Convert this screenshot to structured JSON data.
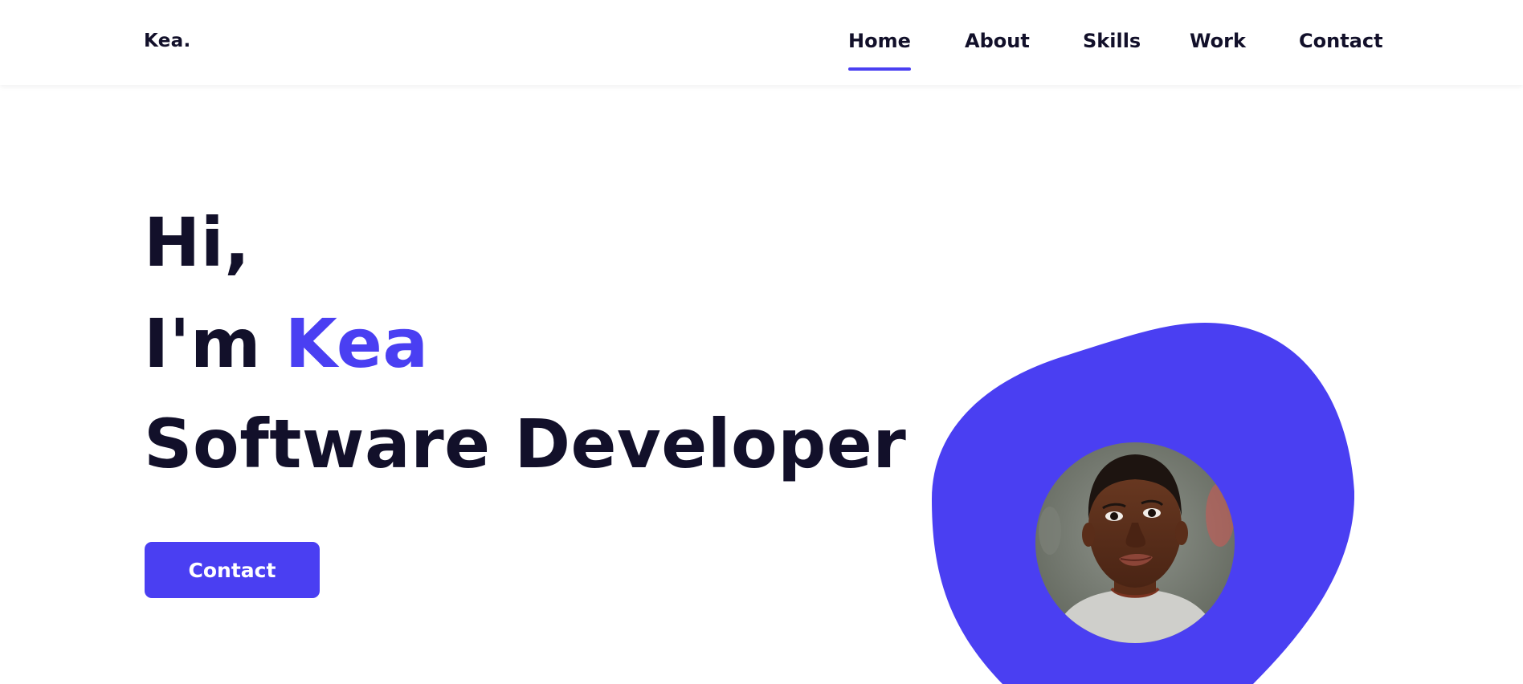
{
  "header": {
    "logo": "Kea.",
    "nav": [
      {
        "label": "Home",
        "active": true
      },
      {
        "label": "About",
        "active": false
      },
      {
        "label": "Skills",
        "active": false
      },
      {
        "label": "Work",
        "active": false
      },
      {
        "label": "Contact",
        "active": false
      }
    ]
  },
  "hero": {
    "greeting": "Hi,",
    "intro_prefix": "I'm",
    "name": "Kea",
    "role": "Software Developer",
    "cta_label": "Contact"
  },
  "colors": {
    "accent": "#4a3ff2",
    "text": "#12102a",
    "background": "#ffffff"
  },
  "icons": {
    "hero_image": "portrait-avatar"
  }
}
